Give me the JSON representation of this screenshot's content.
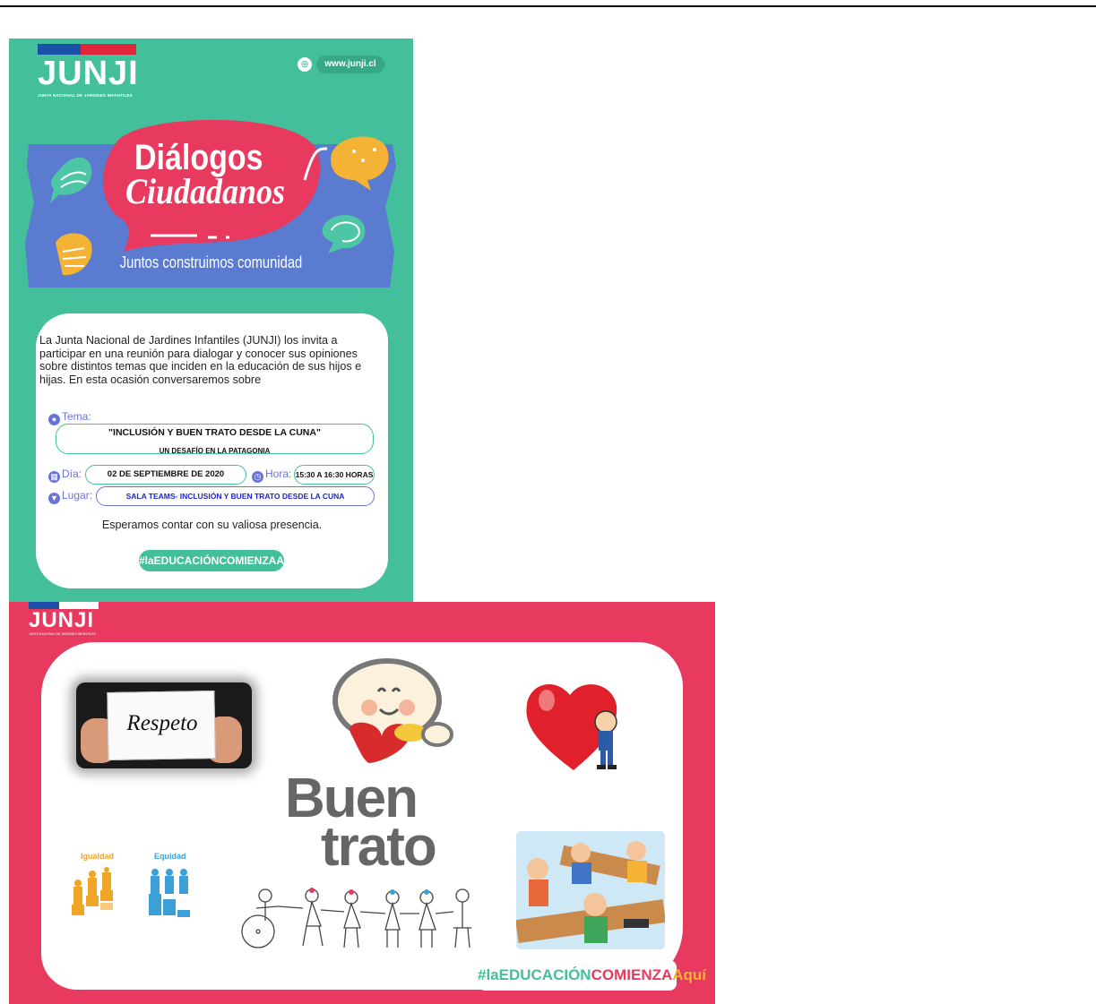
{
  "poster1": {
    "logo": "JUNJI",
    "logo_subtitle": "JUNTA NACIONAL DE JARDINES INFANTILES",
    "website": "www.junji.cl",
    "title_line1": "Diálogos",
    "title_line2": "Ciudadanos",
    "tagline": "Juntos construimos comunidad",
    "intro": "La Junta Nacional de Jardines Infantiles (JUNJI) los invita a participar en una reunión para dialogar y conocer sus opiniones sobre distintos temas que inciden en la educación de sus hijos e hijas. En esta ocasión conversaremos sobre",
    "tema_label": "Tema:",
    "tema_value": "\"INCLUSIÓN Y BUEN TRATO DESDE LA CUNA\"",
    "tema_sub": "UN DESAFÍO EN LA PATAGONIA",
    "dia_label": "Día:",
    "dia_value": "02 DE SEPTIEMBRE DE 2020",
    "hora_label": "Hora:",
    "hora_value": "15:30 A 16:30 HORAS",
    "lugar_label": "Lugar:",
    "lugar_value": "SALA TEAMS- INCLUSIÓN Y BUEN TRATO DESDE LA CUNA",
    "closing": "Esperamos contar con su valiosa presencia.",
    "hashtag": "#laEDUCACIÓNCOMIENZAAquí"
  },
  "poster2": {
    "logo": "JUNJI",
    "logo_subtitle": "JUNTA NACIONAL DE JARDINES INFANTILES",
    "respeto": "Respeto",
    "buen": "Buen",
    "trato": "trato",
    "igualdad": "Igualdad",
    "equidad": "Equidad",
    "hashtag_a": "#la",
    "hashtag_b": "EDUCACIÓN",
    "hashtag_c": "COMIENZA",
    "hashtag_d": "Aquí"
  },
  "colors": {
    "teal": "#43bf9b",
    "pink": "#e8395f",
    "blue": "#5a7bd0",
    "yellow": "#f5b335"
  }
}
